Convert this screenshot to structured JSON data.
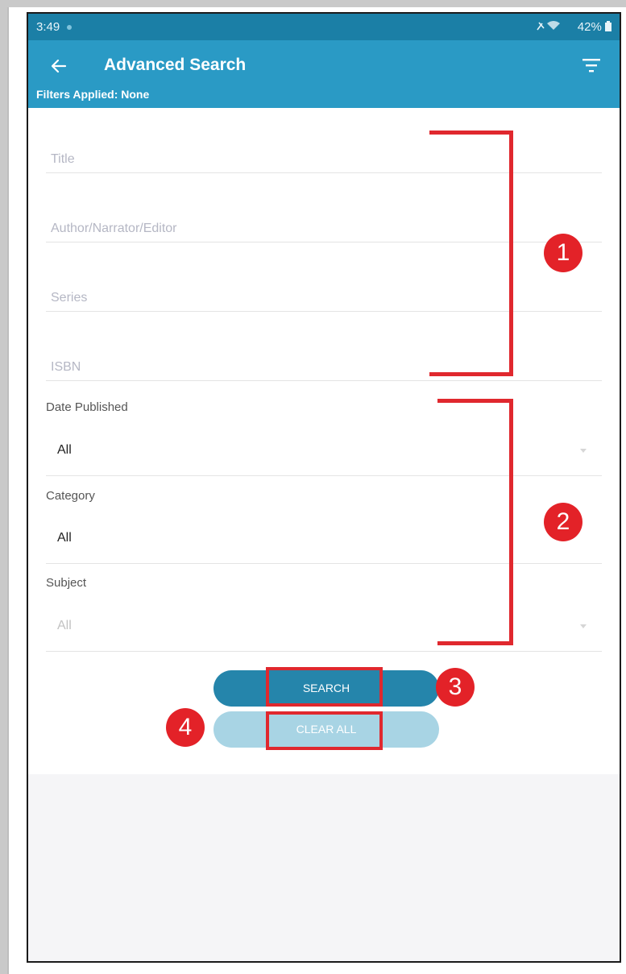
{
  "status_bar": {
    "time": "3:49",
    "right_text": "42%"
  },
  "app_bar": {
    "title": "Advanced Search",
    "filters_applied": "Filters Applied: None"
  },
  "fields": {
    "title_placeholder": "Title",
    "author_placeholder": "Author/Narrator/Editor",
    "series_placeholder": "Series",
    "isbn_placeholder": "ISBN"
  },
  "selects": {
    "date_published": {
      "label": "Date Published",
      "value": "All"
    },
    "category": {
      "label": "Category",
      "value": "All"
    },
    "subject": {
      "label": "Subject",
      "value": "All"
    }
  },
  "buttons": {
    "search_label": "SEARCH",
    "clear_label": "CLEAR ALL"
  },
  "annotations": {
    "badge1": "1",
    "badge2": "2",
    "badge3": "3",
    "badge4": "4"
  },
  "colors": {
    "status_bar": "#1b7fa6",
    "app_bar": "#2a9ac5",
    "search_button": "#2585ab",
    "clear_button": "#a8d4e4",
    "annotation_red": "#e32228"
  },
  "icons": {
    "back": "arrow-left-icon",
    "filter": "filter-icon"
  }
}
